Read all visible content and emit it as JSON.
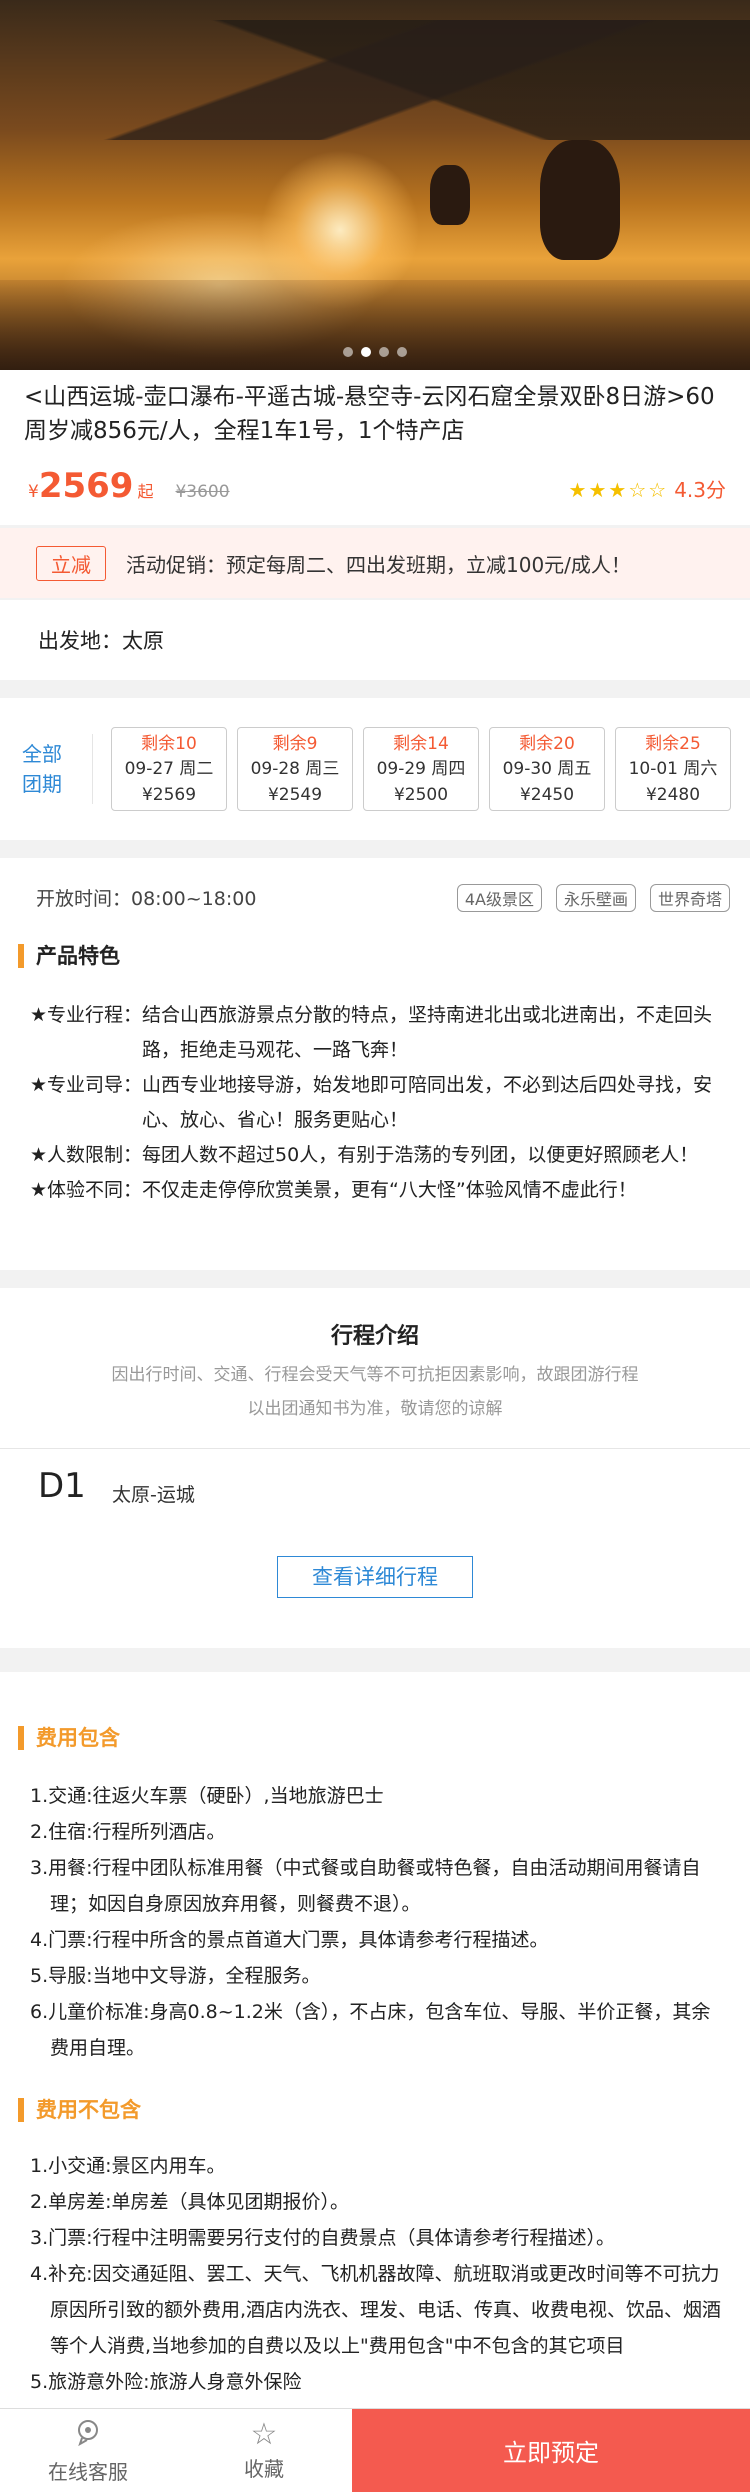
{
  "hero": {
    "slides": 4,
    "active_slide": 2
  },
  "product": {
    "title": "<山西运城-壶口瀑布-平遥古城-悬空寺-云冈石窟全景双卧8日游>60周岁减856元/人，全程1车1号，1个特产店",
    "currency": "¥",
    "price": "2569",
    "price_suffix": "起",
    "original_price": "¥3600",
    "stars": "★★★☆☆",
    "rating": "4.3分"
  },
  "promo": {
    "tag": "立减",
    "text": "活动促销：预定每周二、四出发班期，立减100元/成人！"
  },
  "departure": {
    "text": "出发地：太原"
  },
  "dates": {
    "all_groups": "全部团期",
    "items": [
      {
        "remaining": "剩余10",
        "day": "09-27 周二",
        "price": "¥2569"
      },
      {
        "remaining": "剩余9",
        "day": "09-28 周三",
        "price": "¥2549"
      },
      {
        "remaining": "剩余14",
        "day": "09-29 周四",
        "price": "¥2500"
      },
      {
        "remaining": "剩余20",
        "day": "09-30 周五",
        "price": "¥2450"
      },
      {
        "remaining": "剩余25",
        "day": "10-01 周六",
        "price": "¥2480"
      }
    ]
  },
  "features": {
    "hours": "开放时间：08:00~18:00",
    "tags": [
      "4A级景区",
      "永乐壁画",
      "世界奇塔"
    ],
    "heading": "产品特色",
    "items": [
      {
        "key": "★专业行程：",
        "value": "结合山西旅游景点分散的特点，坚持南进北出或北进南出，不走回头路，拒绝走马观花、一路飞奔！"
      },
      {
        "key": "★专业司导：",
        "value": "山西专业地接导游，始发地即可陪同出发，不必到达后四处寻找，安心、放心、省心！服务更贴心！"
      },
      {
        "key": "★人数限制：",
        "value": "每团人数不超过50人，有别于浩荡的专列团，以便更好照顾老人！"
      },
      {
        "key": "★体验不同：",
        "value": "不仅走走停停欣赏美景，更有“八大怪”体验风情不虚此行！"
      }
    ]
  },
  "itinerary": {
    "title": "行程介绍",
    "note1": "因出行时间、交通、行程会受天气等不可抗拒因素影响，故跟团游行程",
    "note2": "以出团通知书为准，敬请您的谅解",
    "day": "D1",
    "route": "太原-运城",
    "detail_button": "查看详细行程"
  },
  "fees": {
    "included_heading": "费用包含",
    "included": [
      "1.交通:往返火车票（硬卧）,当地旅游巴士",
      "2.住宿:行程所列酒店。",
      "3.用餐:行程中团队标准用餐（中式餐或自助餐或特色餐，自由活动期间用餐请自理；如因自身原因放弃用餐，则餐费不退）。",
      "4.门票:行程中所含的景点首道大门票，具体请参考行程描述。",
      "5.导服:当地中文导游，全程服务。",
      "6.儿童价标准:身高0.8~1.2米（含），不占床，包含车位、导服、半价正餐，其余费用自理。"
    ],
    "excluded_heading": "费用不包含",
    "excluded": [
      "1.小交通:景区内用车。",
      "2.单房差:单房差（具体见团期报价）。",
      "3.门票:行程中注明需要另行支付的自费景点（具体请参考行程描述）。",
      "4.补充:因交通延阻、罢工、天气、飞机机器故障、航班取消或更改时间等不可抗力原因所引致的额外费用,酒店内洗衣、理发、电话、传真、收费电视、饮品、烟酒等个人消费,当地参加的自费以及以上\"费用包含\"中不包含的其它项目",
      "5.旅游意外险:旅游人身意外保险"
    ]
  },
  "bottom_bar": {
    "service_label": "在线客服",
    "favorite_label": "收藏",
    "book_label": "立即预定"
  }
}
